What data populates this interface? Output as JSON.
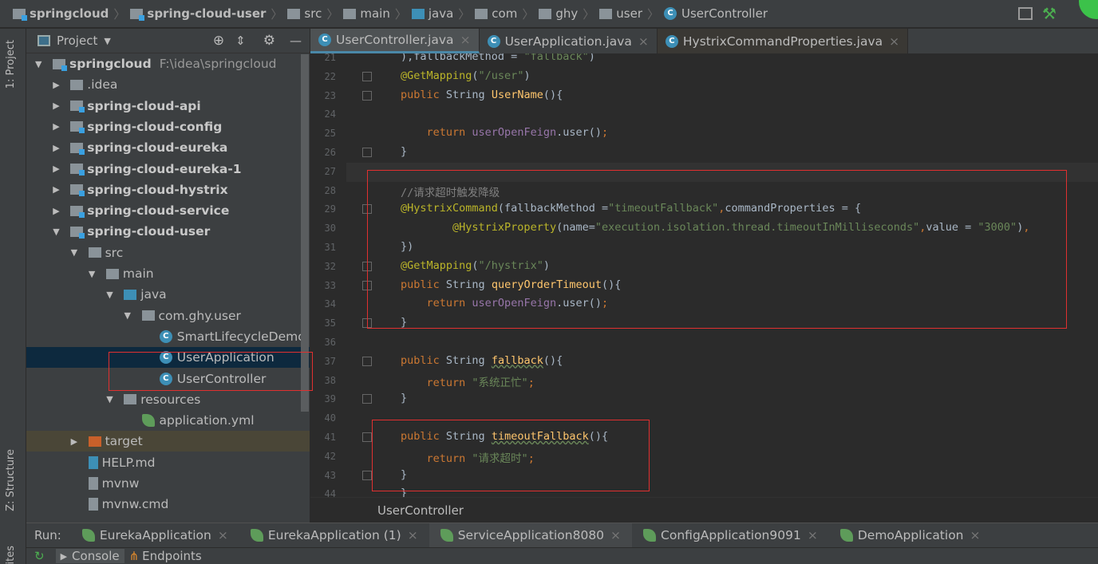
{
  "breadcrumb": [
    "springcloud",
    "spring-cloud-user",
    "src",
    "main",
    "java",
    "com",
    "ghy",
    "user",
    "UserController"
  ],
  "sidebar": {
    "strip_project": "1: Project",
    "strip_structure": "Z: Structure",
    "strip_fav": "ites"
  },
  "project": {
    "title": "Project",
    "tree": [
      {
        "label": "springcloud",
        "path": "F:\\idea\\springcloud",
        "level": 0,
        "arrow": "down",
        "bold": true,
        "icon": "module-folder-icon"
      },
      {
        "label": ".idea",
        "level": 1,
        "arrow": "right",
        "icon": "folder-icon"
      },
      {
        "label": "spring-cloud-api",
        "level": 1,
        "arrow": "right",
        "bold": true,
        "icon": "module-folder-icon"
      },
      {
        "label": "spring-cloud-config",
        "level": 1,
        "arrow": "right",
        "bold": true,
        "icon": "module-folder-icon"
      },
      {
        "label": "spring-cloud-eureka",
        "level": 1,
        "arrow": "right",
        "bold": true,
        "icon": "module-folder-icon"
      },
      {
        "label": "spring-cloud-eureka-1",
        "level": 1,
        "arrow": "right",
        "bold": true,
        "icon": "module-folder-icon"
      },
      {
        "label": "spring-cloud-hystrix",
        "level": 1,
        "arrow": "right",
        "bold": true,
        "icon": "module-folder-icon"
      },
      {
        "label": "spring-cloud-service",
        "level": 1,
        "arrow": "right",
        "bold": true,
        "icon": "module-folder-icon"
      },
      {
        "label": "spring-cloud-user",
        "level": 1,
        "arrow": "down",
        "bold": true,
        "icon": "module-folder-icon"
      },
      {
        "label": "src",
        "level": 2,
        "arrow": "down",
        "icon": "folder-icon"
      },
      {
        "label": "main",
        "level": 3,
        "arrow": "down",
        "icon": "folder-icon"
      },
      {
        "label": "java",
        "level": 4,
        "arrow": "down",
        "icon": "source-folder-icon"
      },
      {
        "label": "com.ghy.user",
        "level": 5,
        "arrow": "down",
        "icon": "package-icon"
      },
      {
        "label": "SmartLifecycleDemo",
        "level": 6,
        "icon": "class-icon"
      },
      {
        "label": "UserApplication",
        "level": 6,
        "icon": "spring-boot-class-icon",
        "selected": true
      },
      {
        "label": "UserController",
        "level": 6,
        "icon": "class-icon"
      },
      {
        "label": "resources",
        "level": 4,
        "arrow": "down",
        "icon": "resources-folder-icon"
      },
      {
        "label": "application.yml",
        "level": 5,
        "icon": "spring-yml-icon"
      },
      {
        "label": "target",
        "level": 2,
        "arrow": "right",
        "icon": "excluded-folder-icon",
        "highlight": true
      },
      {
        "label": "HELP.md",
        "level": 2,
        "icon": "markdown-file-icon"
      },
      {
        "label": "mvnw",
        "level": 2,
        "icon": "file-icon"
      },
      {
        "label": "mvnw.cmd",
        "level": 2,
        "icon": "file-icon"
      }
    ]
  },
  "tabs": [
    {
      "label": "UserController.java",
      "active": true
    },
    {
      "label": "UserApplication.java"
    },
    {
      "label": "HystrixCommandProperties.java"
    }
  ],
  "code": [
    {
      "n": "21",
      "t": [
        [
          "p",
          "),fallbackMethod = "
        ],
        [
          "s",
          "\"fallback\""
        ],
        [
          "p",
          ")"
        ]
      ]
    },
    {
      "n": "22",
      "t": [
        [
          "a",
          "@GetMapping"
        ],
        [
          "p",
          "("
        ],
        [
          "s",
          "\"/user\""
        ],
        [
          "p",
          ")"
        ]
      ]
    },
    {
      "n": "23",
      "t": [
        [
          "k",
          "public "
        ],
        [
          "p",
          "String "
        ],
        [
          "m",
          "UserName"
        ],
        [
          "p",
          "(){"
        ]
      ]
    },
    {
      "n": "24",
      "t": []
    },
    {
      "n": "25",
      "t": [
        [
          "p",
          "    "
        ],
        [
          "k",
          "return "
        ],
        [
          "f",
          "userOpenFeign"
        ],
        [
          "p",
          ".user()"
        ],
        [
          "k",
          ";"
        ]
      ]
    },
    {
      "n": "26",
      "t": [
        [
          "p",
          "}"
        ]
      ]
    },
    {
      "n": "27",
      "t": []
    },
    {
      "n": "28",
      "t": [
        [
          "c",
          "//请求超时触发降级"
        ]
      ]
    },
    {
      "n": "29",
      "t": [
        [
          "a",
          "@HystrixCommand"
        ],
        [
          "p",
          "(fallbackMethod ="
        ],
        [
          "s",
          "\"timeoutFallback\""
        ],
        [
          "k",
          ","
        ],
        [
          "p",
          "commandProperties = {"
        ]
      ]
    },
    {
      "n": "30",
      "t": [
        [
          "p",
          "        "
        ],
        [
          "a",
          "@HystrixProperty"
        ],
        [
          "p",
          "(name="
        ],
        [
          "s",
          "\"execution.isolation.thread.timeoutInMilliseconds\""
        ],
        [
          "k",
          ","
        ],
        [
          "p",
          "value = "
        ],
        [
          "s",
          "\"3000\""
        ],
        [
          "p",
          ")"
        ],
        [
          "k",
          ","
        ]
      ]
    },
    {
      "n": "31",
      "t": [
        [
          "p",
          "})"
        ]
      ]
    },
    {
      "n": "32",
      "t": [
        [
          "a",
          "@GetMapping"
        ],
        [
          "p",
          "("
        ],
        [
          "s",
          "\"/hystrix\""
        ],
        [
          "p",
          ")"
        ]
      ]
    },
    {
      "n": "33",
      "t": [
        [
          "k",
          "public "
        ],
        [
          "p",
          "String "
        ],
        [
          "m",
          "queryOrderTimeout"
        ],
        [
          "p",
          "(){"
        ]
      ]
    },
    {
      "n": "34",
      "t": [
        [
          "p",
          "    "
        ],
        [
          "k",
          "return "
        ],
        [
          "f",
          "userOpenFeign"
        ],
        [
          "p",
          ".user()"
        ],
        [
          "k",
          ";"
        ]
      ]
    },
    {
      "n": "35",
      "t": [
        [
          "p",
          "}"
        ]
      ]
    },
    {
      "n": "36",
      "t": []
    },
    {
      "n": "37",
      "t": [
        [
          "k",
          "public "
        ],
        [
          "p",
          "String "
        ],
        [
          "m",
          "fallback"
        ],
        [
          "p",
          "(){"
        ]
      ]
    },
    {
      "n": "38",
      "t": [
        [
          "p",
          "    "
        ],
        [
          "k",
          "return "
        ],
        [
          "s",
          "\"系统正忙\""
        ],
        [
          "k",
          ";"
        ]
      ]
    },
    {
      "n": "39",
      "t": [
        [
          "p",
          "}"
        ]
      ]
    },
    {
      "n": "40",
      "t": []
    },
    {
      "n": "41",
      "t": [
        [
          "k",
          "public "
        ],
        [
          "p",
          "String "
        ],
        [
          "m",
          "timeoutFallback"
        ],
        [
          "p",
          "(){"
        ]
      ]
    },
    {
      "n": "42",
      "t": [
        [
          "p",
          "    "
        ],
        [
          "k",
          "return "
        ],
        [
          "s",
          "\"请求超时\""
        ],
        [
          "k",
          ";"
        ]
      ]
    },
    {
      "n": "43",
      "t": [
        [
          "p",
          "}"
        ]
      ]
    },
    {
      "n": "44",
      "t": [
        [
          "p",
          "}"
        ]
      ]
    }
  ],
  "editor_breadcrumb": "UserController",
  "run": {
    "label": "Run:",
    "tabs": [
      {
        "label": "EurekaApplication"
      },
      {
        "label": "EurekaApplication (1)"
      },
      {
        "label": "ServiceApplication8080",
        "active": true
      },
      {
        "label": "ConfigApplication9091"
      },
      {
        "label": "DemoApplication"
      }
    ]
  },
  "console": {
    "tabs": [
      "Console",
      "Endpoints"
    ]
  }
}
